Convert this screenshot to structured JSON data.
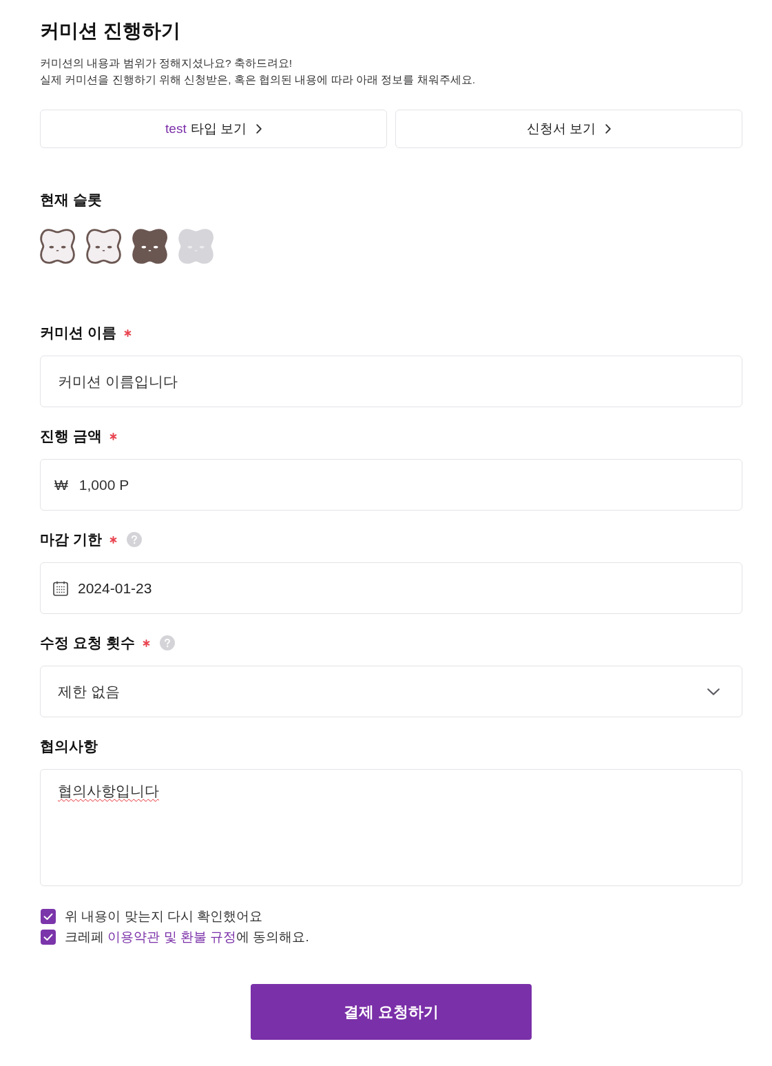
{
  "title": "커미션 진행하기",
  "intro": [
    "커미션의 내용과 범위가 정해지셨나요? 축하드려요!",
    "실제 커미션을 진행하기 위해 신청받은, 혹은 협의된 내용에 따라 아래 정보를 채워주세요."
  ],
  "view_buttons": [
    {
      "accent": "test",
      "label": "타입 보기"
    },
    {
      "label": "신청서 보기"
    }
  ],
  "slots": {
    "label": "현재 슬롯",
    "items": [
      {
        "kind": "outline"
      },
      {
        "kind": "outline"
      },
      {
        "kind": "solid"
      },
      {
        "kind": "faded"
      }
    ]
  },
  "fields": [
    {
      "kind": "text",
      "label": "커미션 이름",
      "required": true,
      "help": false,
      "value": "커미션 이름입니다"
    },
    {
      "kind": "amount",
      "label": "진행 금액",
      "required": true,
      "help": false,
      "prefix": "₩",
      "value": "1,000 P"
    },
    {
      "kind": "date",
      "label": "마감 기한",
      "required": true,
      "help": true,
      "value": "2024-01-23"
    },
    {
      "kind": "select",
      "label": "수정 요청 횟수",
      "required": true,
      "help": true,
      "value": "제한 없음"
    },
    {
      "kind": "textarea",
      "label": "협의사항",
      "required": false,
      "help": false,
      "value": "협의사항입니다",
      "misspelled": true
    }
  ],
  "agreements": [
    {
      "checked": true,
      "parts": [
        {
          "kind": "text",
          "text": "위 내용이 맞는지 다시 확인했어요"
        }
      ]
    },
    {
      "checked": true,
      "parts": [
        {
          "kind": "text",
          "text": "크레페 "
        },
        {
          "kind": "link",
          "text": "이용약관 및 환불 규정"
        },
        {
          "kind": "text",
          "text": "에 동의해요."
        }
      ]
    }
  ],
  "submit": {
    "label": "결제 요청하기"
  }
}
